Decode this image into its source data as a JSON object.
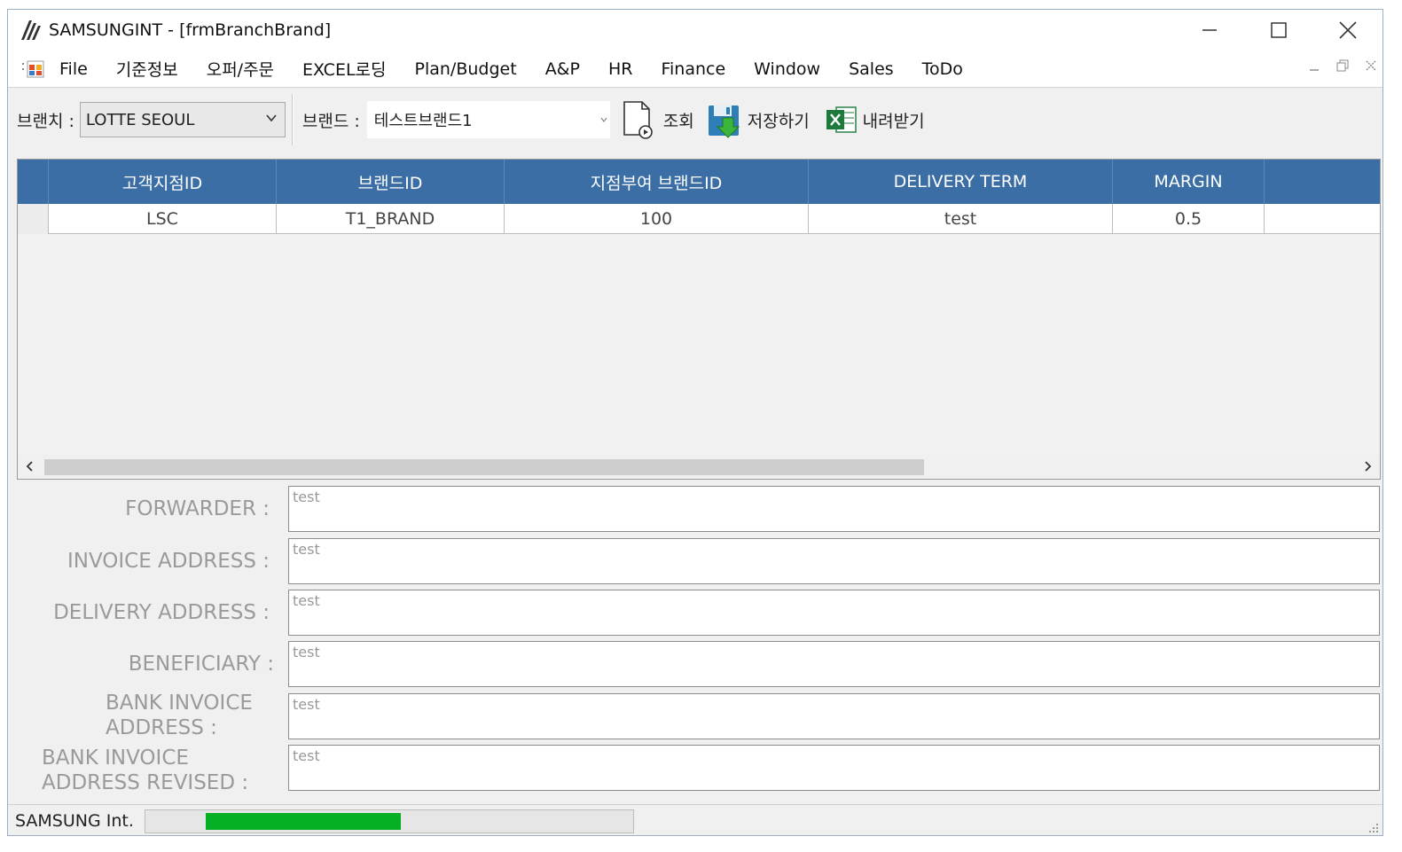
{
  "window": {
    "title": "SAMSUNGINT - [frmBranchBrand]"
  },
  "menu": {
    "items": [
      "File",
      "기준정보",
      "오퍼/주문",
      "EXCEL로딩",
      "Plan/Budget",
      "A&P",
      "HR",
      "Finance",
      "Window",
      "Sales",
      "ToDo"
    ]
  },
  "toolbar": {
    "branch_label": "브랜치 :",
    "branch_value": "LOTTE SEOUL",
    "brand_label": "브랜드 :",
    "brand_value": "테스트브랜드1",
    "search_label": "조회",
    "save_label": "저장하기",
    "download_label": "내려받기"
  },
  "grid": {
    "columns": [
      "고객지점ID",
      "브랜드ID",
      "지점부여 브랜드ID",
      "DELIVERY TERM",
      "MARGIN"
    ],
    "rows": [
      [
        "LSC",
        "T1_BRAND",
        "100",
        "test",
        "0.5"
      ]
    ]
  },
  "form": {
    "fields": [
      {
        "label": "FORWARDER :",
        "value": "test"
      },
      {
        "label": "INVOICE ADDRESS :",
        "value": "test"
      },
      {
        "label": "DELIVERY ADDRESS :",
        "value": "test"
      },
      {
        "label": "BENEFICIARY :",
        "value": "test"
      },
      {
        "label": "BANK INVOICE ADDRESS :",
        "value": "test"
      },
      {
        "label": "BANK INVOICE ADDRESS REVISED :",
        "value": "test"
      }
    ]
  },
  "status": {
    "text": "SAMSUNG Int.",
    "progress": 0.4
  },
  "colors": {
    "grid_header": "#3a6ea5",
    "progress_fill": "#06b025"
  }
}
